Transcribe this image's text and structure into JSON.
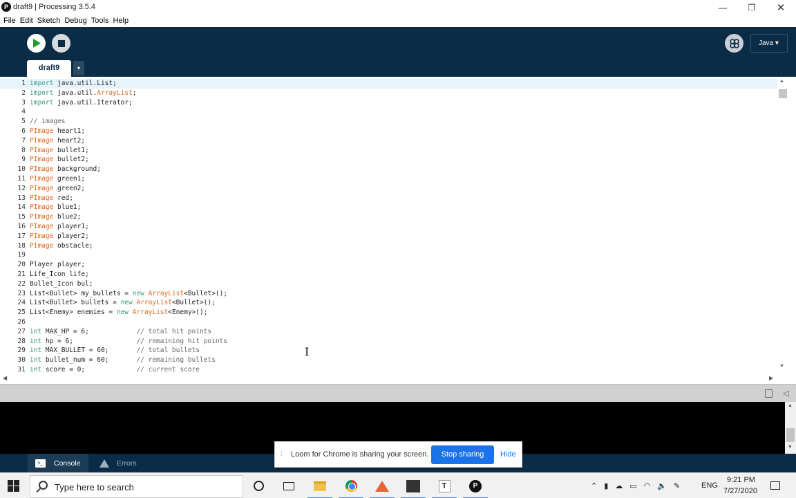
{
  "window": {
    "app_icon": "P",
    "title": "draft9 | Processing 3.5.4",
    "minimize": "—",
    "maximize": "❐",
    "close": "✕"
  },
  "menu": [
    "File",
    "Edit",
    "Sketch",
    "Debug",
    "Tools",
    "Help"
  ],
  "toolbar": {
    "run_icon": "play-icon",
    "stop_icon": "stop-icon",
    "debug_icon": "butterfly-icon",
    "mode_label": "Java ▾"
  },
  "tabs": {
    "active": "draft9",
    "menu_arrow": "▾"
  },
  "editor": {
    "line_numbers": [
      "1",
      "2",
      "3",
      "4",
      "5",
      "6",
      "7",
      "8",
      "9",
      "10",
      "11",
      "12",
      "13",
      "14",
      "15",
      "16",
      "17",
      "18",
      "19",
      "20",
      "21",
      "22",
      "23",
      "24",
      "25",
      "26",
      "27",
      "28",
      "29",
      "30",
      "31"
    ],
    "lines": [
      [
        {
          "t": "kw",
          "v": "import"
        },
        {
          "t": "",
          "v": " java.util.List;"
        }
      ],
      [
        {
          "t": "kw",
          "v": "import"
        },
        {
          "t": "",
          "v": " java.util."
        },
        {
          "t": "ty",
          "v": "ArrayList"
        },
        {
          "t": "",
          "v": ";"
        }
      ],
      [
        {
          "t": "kw",
          "v": "import"
        },
        {
          "t": "",
          "v": " java.util.Iterator;"
        }
      ],
      [],
      [
        {
          "t": "cm",
          "v": "// images"
        }
      ],
      [
        {
          "t": "ty",
          "v": "PImage"
        },
        {
          "t": "",
          "v": " heart1;"
        }
      ],
      [
        {
          "t": "ty",
          "v": "PImage"
        },
        {
          "t": "",
          "v": " heart2;"
        }
      ],
      [
        {
          "t": "ty",
          "v": "PImage"
        },
        {
          "t": "",
          "v": " bullet1;"
        }
      ],
      [
        {
          "t": "ty",
          "v": "PImage"
        },
        {
          "t": "",
          "v": " bullet2;"
        }
      ],
      [
        {
          "t": "ty",
          "v": "PImage"
        },
        {
          "t": "",
          "v": " background;"
        }
      ],
      [
        {
          "t": "ty",
          "v": "PImage"
        },
        {
          "t": "",
          "v": " green1;"
        }
      ],
      [
        {
          "t": "ty",
          "v": "PImage"
        },
        {
          "t": "",
          "v": " green2;"
        }
      ],
      [
        {
          "t": "ty",
          "v": "PImage"
        },
        {
          "t": "",
          "v": " red;"
        }
      ],
      [
        {
          "t": "ty",
          "v": "PImage"
        },
        {
          "t": "",
          "v": " blue1;"
        }
      ],
      [
        {
          "t": "ty",
          "v": "PImage"
        },
        {
          "t": "",
          "v": " blue2;"
        }
      ],
      [
        {
          "t": "ty",
          "v": "PImage"
        },
        {
          "t": "",
          "v": " player1;"
        }
      ],
      [
        {
          "t": "ty",
          "v": "PImage"
        },
        {
          "t": "",
          "v": " player2;"
        }
      ],
      [
        {
          "t": "ty",
          "v": "PImage"
        },
        {
          "t": "",
          "v": " obstacle;"
        }
      ],
      [],
      [
        {
          "t": "",
          "v": "Player player;"
        }
      ],
      [
        {
          "t": "",
          "v": "Life_Icon life;"
        }
      ],
      [
        {
          "t": "",
          "v": "Bullet_Icon bul;"
        }
      ],
      [
        {
          "t": "",
          "v": "List<Bullet> my_bullets = "
        },
        {
          "t": "kw",
          "v": "new"
        },
        {
          "t": "",
          "v": " "
        },
        {
          "t": "ty",
          "v": "ArrayList"
        },
        {
          "t": "",
          "v": "<Bullet>();"
        }
      ],
      [
        {
          "t": "",
          "v": "List<Bullet> bullets = "
        },
        {
          "t": "kw",
          "v": "new"
        },
        {
          "t": "",
          "v": " "
        },
        {
          "t": "ty",
          "v": "ArrayList"
        },
        {
          "t": "",
          "v": "<Bullet>();"
        }
      ],
      [
        {
          "t": "",
          "v": "List<Enemy> enemies = "
        },
        {
          "t": "kw",
          "v": "new"
        },
        {
          "t": "",
          "v": " "
        },
        {
          "t": "ty",
          "v": "ArrayList"
        },
        {
          "t": "",
          "v": "<Enemy>();"
        }
      ],
      [],
      [
        {
          "t": "kw",
          "v": "int"
        },
        {
          "t": "",
          "v": " MAX_HP = 6;            "
        },
        {
          "t": "cm",
          "v": "// total hit points"
        }
      ],
      [
        {
          "t": "kw",
          "v": "int"
        },
        {
          "t": "",
          "v": " hp = 6;                "
        },
        {
          "t": "cm",
          "v": "// remaining hit points"
        }
      ],
      [
        {
          "t": "kw",
          "v": "int"
        },
        {
          "t": "",
          "v": " MAX_BULLET = 60;       "
        },
        {
          "t": "cm",
          "v": "// total bullets"
        }
      ],
      [
        {
          "t": "kw",
          "v": "int"
        },
        {
          "t": "",
          "v": " bullet_num = 60;       "
        },
        {
          "t": "cm",
          "v": "// remaining bullets"
        }
      ],
      [
        {
          "t": "kw",
          "v": "int"
        },
        {
          "t": "",
          "v": " score = 0;             "
        },
        {
          "t": "cm",
          "v": "// current score"
        }
      ]
    ]
  },
  "scroll": {
    "up": "▲",
    "down": "▼",
    "left": "◀",
    "right": "▶"
  },
  "console_tabs": {
    "console_label": "Console",
    "console_icon_glyph": ">_",
    "errors_label": "Errors",
    "collapse_glyph": "◁"
  },
  "loom": {
    "grip": "⁞",
    "message": "Loom for Chrome is sharing your screen.",
    "stop_label": "Stop sharing",
    "hide_label": "Hide"
  },
  "taskbar": {
    "search_placeholder": "Type here to search",
    "apps": [
      "cortana-icon",
      "task-view-icon",
      "file-explorer-icon",
      "chrome-icon",
      "matlab-icon",
      "terminal-icon",
      "typora-icon",
      "processing-icon"
    ],
    "typora_glyph": "T",
    "processing_glyph": "P",
    "tray_glyphs": [
      "⌃",
      "▮",
      "☁",
      "▭",
      "◠",
      "🔈",
      "✎"
    ],
    "language": "ENG",
    "time": "9:21 PM",
    "date": "7/27/2020"
  },
  "colors": {
    "toolbar_bg": "#0a2c47",
    "keyword": "#33997e",
    "type": "#e2661a",
    "comment": "#666666",
    "loom_blue": "#1a73e8"
  }
}
